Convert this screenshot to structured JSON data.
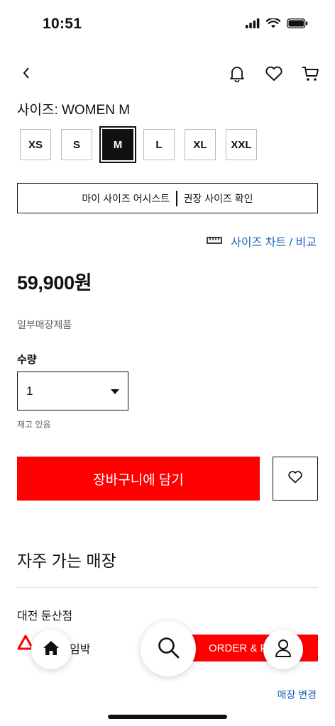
{
  "status_bar": {
    "time": "10:51"
  },
  "product": {
    "size_label": "사이즈: WOMEN M",
    "sizes": [
      "XS",
      "S",
      "M",
      "L",
      "XL",
      "XXL"
    ],
    "selected_size": "M",
    "size_assist": "마이 사이즈 어시스트",
    "size_recommend": "권장 사이즈 확인",
    "size_chart_link": "사이즈 차트 / 비교",
    "price": "59,900원",
    "store_note": "일부매장제품",
    "quantity_label": "수량",
    "quantity_value": "1",
    "stock_status": "재고 있음",
    "add_to_cart": "장바구니에 담기"
  },
  "stores": {
    "title": "자주 가는 매장",
    "store_name": "대전 둔산점",
    "alert_text": "임박",
    "order_button": "ORDER & P",
    "change_store": "매장 변경"
  },
  "colors": {
    "accent_red": "#ff0000",
    "link_blue": "#1b62b8"
  },
  "icons": [
    "back-chevron-icon",
    "bell-icon",
    "heart-icon",
    "cart-icon",
    "ruler-icon",
    "warning-triangle-icon",
    "home-icon",
    "search-icon",
    "user-icon"
  ]
}
